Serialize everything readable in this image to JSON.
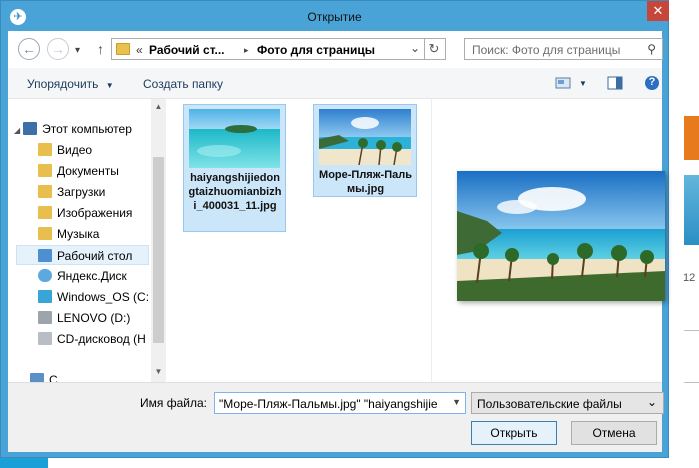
{
  "window": {
    "title": "Открытие",
    "close_glyph": "✕"
  },
  "nav": {
    "back_glyph": "←",
    "forward_glyph": "→",
    "up_glyph": "↑",
    "recent_glyph": "▾",
    "breadcrumb_overflow": "«",
    "breadcrumb": [
      "Рабочий ст...",
      "Фото для страницы"
    ],
    "breadcrumb_sep": "▸",
    "address_dropdown": "⌄",
    "refresh_glyph": "↻",
    "search_placeholder": "Поиск: Фото для страницы",
    "search_glyph": "⚲"
  },
  "toolbar": {
    "organize_label": "Упорядочить",
    "organize_arrow": "▼",
    "new_folder_label": "Создать папку",
    "view_arrow": "▼",
    "help_glyph": "?"
  },
  "sidebar": {
    "items": [
      {
        "label": "Этот компьютер",
        "icon": "computer-icon"
      },
      {
        "label": "Видео",
        "icon": "video-folder-icon"
      },
      {
        "label": "Документы",
        "icon": "documents-folder-icon"
      },
      {
        "label": "Загрузки",
        "icon": "downloads-folder-icon"
      },
      {
        "label": "Изображения",
        "icon": "pictures-folder-icon"
      },
      {
        "label": "Музыка",
        "icon": "music-folder-icon"
      },
      {
        "label": "Рабочий стол",
        "icon": "desktop-folder-icon"
      },
      {
        "label": "Яндекс.Диск",
        "icon": "yandex-disk-icon"
      },
      {
        "label": "Windows_OS (C:",
        "icon": "drive-c-icon"
      },
      {
        "label": "LENOVO (D:)",
        "icon": "drive-d-icon"
      },
      {
        "label": "CD-дисковод (Н",
        "icon": "cd-drive-icon"
      },
      {
        "label": "С...",
        "icon": "network-icon"
      }
    ],
    "expand_glyph": "▸"
  },
  "files": [
    {
      "name": "haiyangshijiedongtaizhuomianbizhi_400031_11.jpg",
      "type": "image"
    },
    {
      "name": "Море-Пляж-Пальмы.jpg",
      "type": "image"
    }
  ],
  "bottom": {
    "filename_label": "Имя файла:",
    "filename_value": "\"Море-Пляж-Пальмы.jpg\" \"haiyangshijie",
    "filename_arrow": "▼",
    "filetype_value": "Пользовательские файлы",
    "filetype_arrow": "⌄",
    "open_label": "Открыть",
    "cancel_label": "Отмена"
  },
  "background": {
    "side_text": "12"
  }
}
